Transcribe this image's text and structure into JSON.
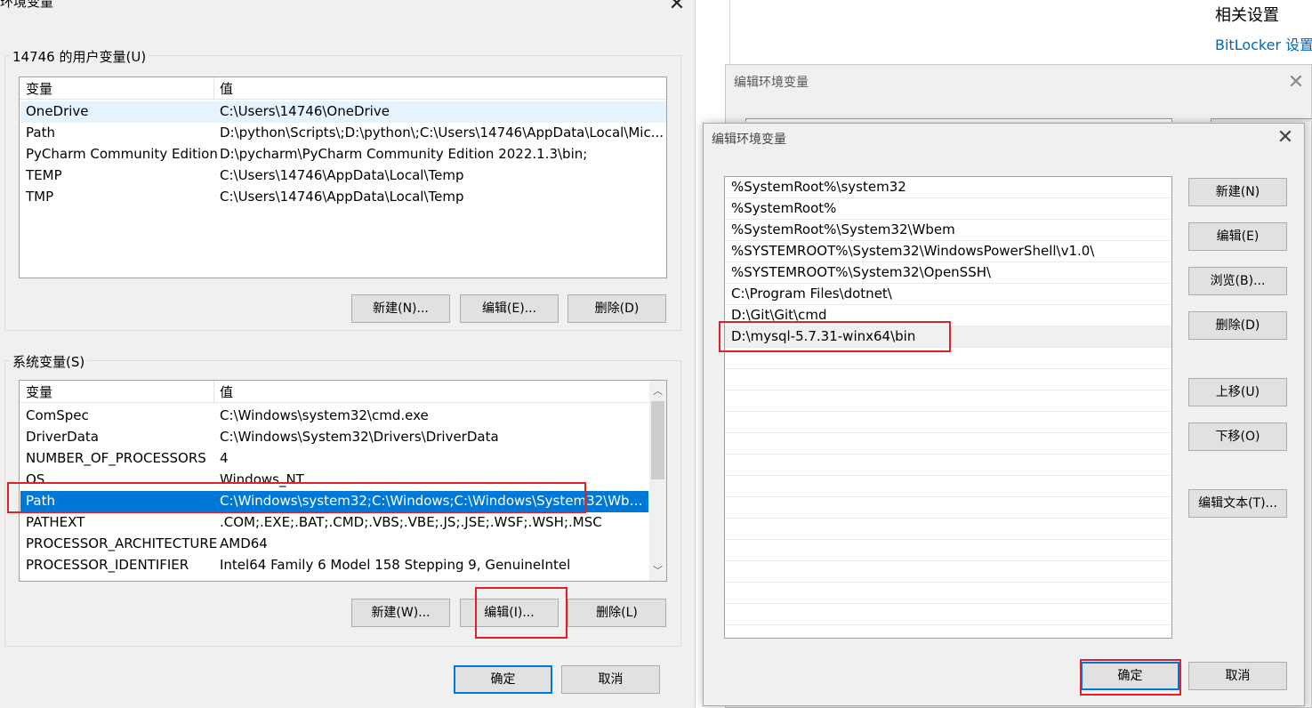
{
  "env_window": {
    "title": "环境变量",
    "close_glyph": "✕",
    "user_vars": {
      "group_label": "14746 的用户变量(U)",
      "col_variable": "变量",
      "col_value": "值",
      "rows": [
        {
          "name": "OneDrive",
          "value": "C:\\Users\\14746\\OneDrive"
        },
        {
          "name": "Path",
          "value": "D:\\python\\Scripts\\;D:\\python\\;C:\\Users\\14746\\AppData\\Local\\Mic..."
        },
        {
          "name": "PyCharm Community Edition",
          "value": "D:\\pycharm\\PyCharm Community Edition 2022.1.3\\bin;"
        },
        {
          "name": "TEMP",
          "value": "C:\\Users\\14746\\AppData\\Local\\Temp"
        },
        {
          "name": "TMP",
          "value": "C:\\Users\\14746\\AppData\\Local\\Temp"
        }
      ],
      "btn_new": "新建(N)...",
      "btn_edit": "编辑(E)...",
      "btn_delete": "删除(D)"
    },
    "system_vars": {
      "group_label": "系统变量(S)",
      "col_variable": "变量",
      "col_value": "值",
      "rows": [
        {
          "name": "ComSpec",
          "value": "C:\\Windows\\system32\\cmd.exe"
        },
        {
          "name": "DriverData",
          "value": "C:\\Windows\\System32\\Drivers\\DriverData"
        },
        {
          "name": "NUMBER_OF_PROCESSORS",
          "value": "4"
        },
        {
          "name": "OS",
          "value": "Windows_NT"
        },
        {
          "name": "Path",
          "value": "C:\\Windows\\system32;C:\\Windows;C:\\Windows\\System32\\Wbe..."
        },
        {
          "name": "PATHEXT",
          "value": ".COM;.EXE;.BAT;.CMD;.VBS;.VBE;.JS;.JSE;.WSF;.WSH;.MSC"
        },
        {
          "name": "PROCESSOR_ARCHITECTURE",
          "value": "AMD64"
        },
        {
          "name": "PROCESSOR_IDENTIFIER",
          "value": "Intel64 Family 6 Model 158 Stepping 9, GenuineIntel"
        }
      ],
      "selected_index": 4,
      "btn_new": "新建(W)...",
      "btn_edit": "编辑(I)...",
      "btn_delete": "删除(L)",
      "scroll_up_glyph": "︿",
      "scroll_down_glyph": "﹀"
    },
    "btn_ok": "确定",
    "btn_cancel": "取消"
  },
  "settings_bg": {
    "related_settings": "相关设置",
    "bitlocker_link": "BitLocker 设置"
  },
  "back_dialog": {
    "title": "编辑环境变量",
    "close_glyph": "✕"
  },
  "edit_dialog": {
    "title": "编辑环境变量",
    "close_glyph": "✕",
    "entries": [
      "%SystemRoot%\\system32",
      "%SystemRoot%",
      "%SystemRoot%\\System32\\Wbem",
      "%SYSTEMROOT%\\System32\\WindowsPowerShell\\v1.0\\",
      "%SYSTEMROOT%\\System32\\OpenSSH\\",
      "C:\\Program Files\\dotnet\\",
      "D:\\Git\\Git\\cmd",
      "D:\\mysql-5.7.31-winx64\\bin"
    ],
    "selected_index": 7,
    "btn_new": "新建(N)",
    "btn_edit": "编辑(E)",
    "btn_browse": "浏览(B)...",
    "btn_delete": "删除(D)",
    "btn_move_up": "上移(U)",
    "btn_move_down": "下移(O)",
    "btn_edit_text": "编辑文本(T)...",
    "btn_ok": "确定",
    "btn_cancel": "取消"
  },
  "colors": {
    "selection": "#0078d7",
    "annotation_red": "#e0212a",
    "link": "#0067c0"
  }
}
